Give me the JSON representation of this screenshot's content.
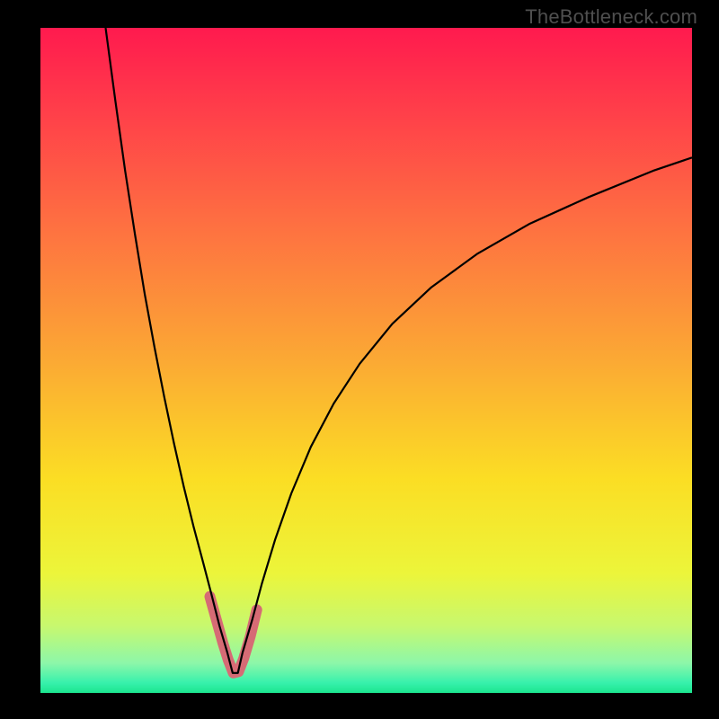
{
  "watermark": "TheBottleneck.com",
  "chart_data": {
    "type": "line",
    "title": "",
    "xlabel": "",
    "ylabel": "",
    "xlim": [
      0,
      100
    ],
    "ylim": [
      0,
      100
    ],
    "legend": false,
    "grid": false,
    "gradient_stops": [
      {
        "offset": 0,
        "color": "#ff1a4e"
      },
      {
        "offset": 0.12,
        "color": "#ff3d4a"
      },
      {
        "offset": 0.3,
        "color": "#fe7141"
      },
      {
        "offset": 0.5,
        "color": "#fba934"
      },
      {
        "offset": 0.68,
        "color": "#fbde24"
      },
      {
        "offset": 0.82,
        "color": "#ecf53a"
      },
      {
        "offset": 0.9,
        "color": "#c7f86f"
      },
      {
        "offset": 0.955,
        "color": "#8df7a9"
      },
      {
        "offset": 0.985,
        "color": "#37f1ac"
      },
      {
        "offset": 1.0,
        "color": "#1be58e"
      }
    ],
    "series": [
      {
        "name": "curve",
        "stroke": "#000000",
        "stroke_width": 2.2,
        "x": [
          10.0,
          11.5,
          13.0,
          14.5,
          16.0,
          17.5,
          19.0,
          20.5,
          22.0,
          23.5,
          25.0,
          26.2,
          27.5,
          28.7,
          29.5,
          30.3,
          31.0,
          32.5,
          34.0,
          36.0,
          38.5,
          41.5,
          45.0,
          49.0,
          54.0,
          60.0,
          67.0,
          75.0,
          84.0,
          94.0,
          100.0
        ],
        "y": [
          100.0,
          89.0,
          78.5,
          69.0,
          60.0,
          52.0,
          44.5,
          37.5,
          31.0,
          25.0,
          19.5,
          15.0,
          10.0,
          6.0,
          3.0,
          3.0,
          6.0,
          11.0,
          16.5,
          23.0,
          30.0,
          37.0,
          43.5,
          49.5,
          55.5,
          61.0,
          66.0,
          70.5,
          74.5,
          78.5,
          80.5
        ]
      },
      {
        "name": "highlight",
        "stroke": "#d66b75",
        "stroke_width": 12,
        "linecap": "round",
        "x": [
          26.0,
          27.0,
          28.0,
          28.8,
          29.6,
          30.4,
          31.2,
          32.2,
          33.2
        ],
        "y": [
          14.5,
          11.0,
          7.5,
          5.0,
          3.0,
          3.2,
          5.2,
          8.5,
          12.5
        ]
      }
    ]
  }
}
